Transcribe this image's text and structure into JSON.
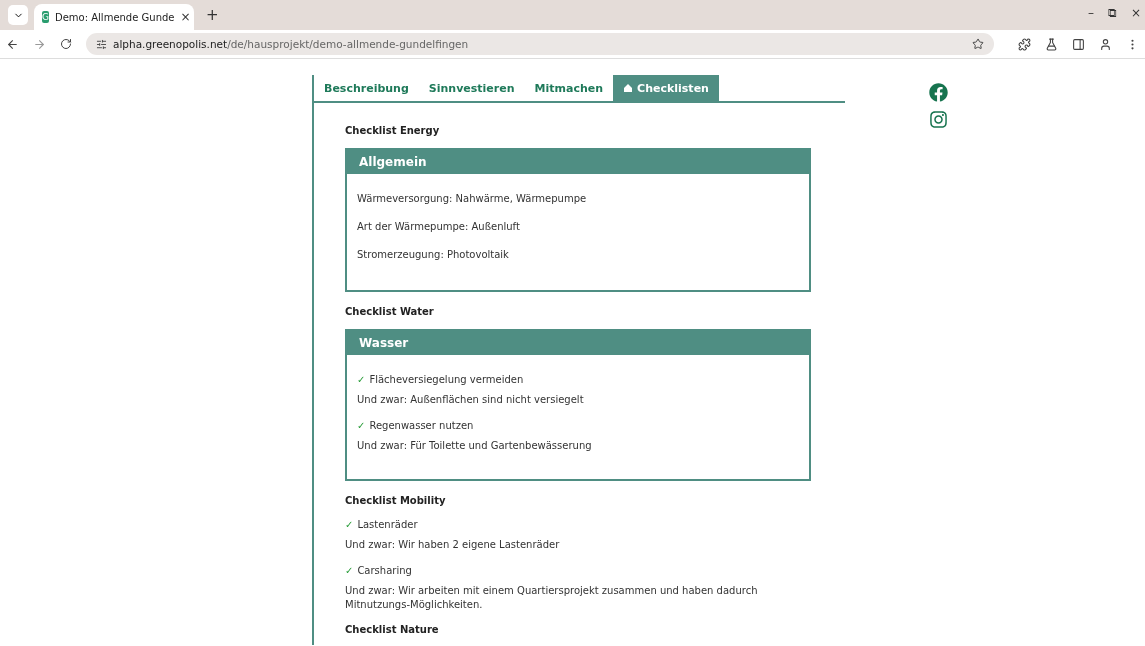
{
  "browser": {
    "tab_title": "Demo: Allmende Gunde",
    "favicon": "G",
    "tab_close": "×",
    "new_tab": "+",
    "url_host": "alpha.greenopolis.net",
    "url_path": "/de/hausprojekt/demo-allmende-gundelfingen",
    "window_controls": [
      "–",
      "⧉",
      "×"
    ]
  },
  "tabs": [
    {
      "label": "Beschreibung",
      "selected": false
    },
    {
      "label": "Sinnvestieren",
      "selected": false
    },
    {
      "label": "Mitmachen",
      "selected": false
    },
    {
      "label": "Checklisten",
      "selected": true
    }
  ],
  "sections": [
    {
      "heading": "Checklist Energy",
      "boxed": true,
      "box_title": "Allgemein",
      "items": [
        {
          "kind": "line",
          "text": "Wärmeversorgung: Nahwärme, Wärmepumpe"
        },
        {
          "kind": "line",
          "text": "Art der Wärmepumpe: Außenluft"
        },
        {
          "kind": "line",
          "text": "Stromerzeugung: Photovoltaik"
        }
      ]
    },
    {
      "heading": "Checklist Water",
      "boxed": true,
      "box_title": "Wasser",
      "items": [
        {
          "kind": "check",
          "mark": "✓",
          "text": "Flächeversiegelung vermeiden",
          "detail": "Und zwar: Außenflächen sind nicht versiegelt"
        },
        {
          "kind": "check",
          "mark": "✓",
          "text": "Regenwasser nutzen",
          "detail": "Und zwar: Für Toilette und Gartenbewässerung"
        }
      ]
    },
    {
      "heading": "Checklist Mobility",
      "boxed": false,
      "items": [
        {
          "kind": "check",
          "mark": "✓",
          "text": "Lastenräder",
          "detail": "Und zwar: Wir haben 2 eigene Lastenräder"
        },
        {
          "kind": "check",
          "mark": "✓",
          "text": "Carsharing",
          "detail": "Und zwar: Wir arbeiten mit einem Quartiersprojekt zusammen und haben dadurch Mitnutzungs-Möglichkeiten."
        }
      ]
    },
    {
      "heading": "Checklist Nature",
      "boxed": false
    }
  ]
}
